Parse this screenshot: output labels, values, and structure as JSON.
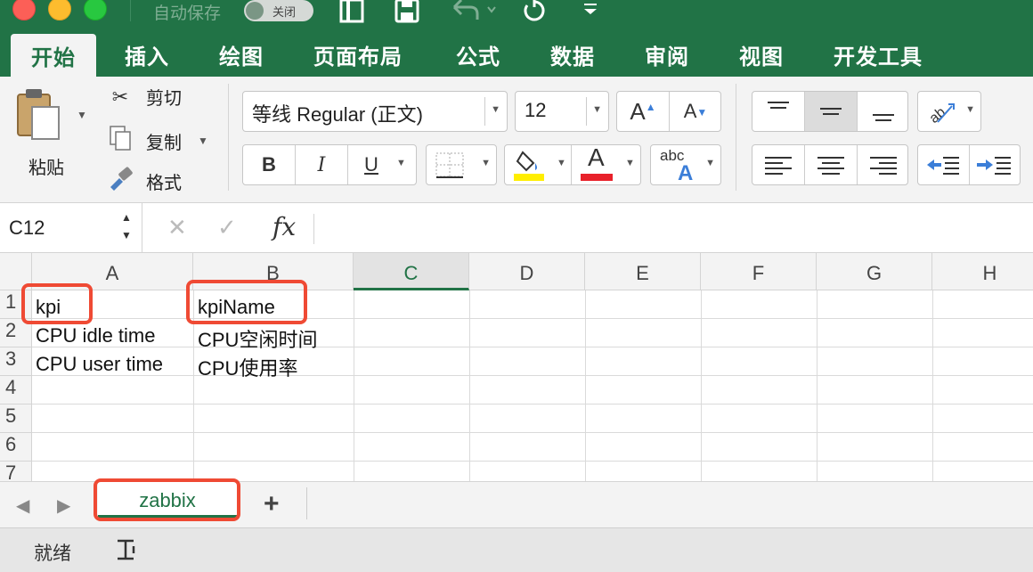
{
  "titlebar": {
    "autosave_label": "自动保存",
    "autosave_state": "关闭"
  },
  "tabs": [
    {
      "label": "开始",
      "active": true
    },
    {
      "label": "插入"
    },
    {
      "label": "绘图"
    },
    {
      "label": "页面布局"
    },
    {
      "label": "公式"
    },
    {
      "label": "数据"
    },
    {
      "label": "审阅"
    },
    {
      "label": "视图"
    },
    {
      "label": "开发工具"
    }
  ],
  "clipboard": {
    "paste": "粘贴",
    "cut": "剪切",
    "copy": "复制",
    "format": "格式"
  },
  "font": {
    "name": "等线 Regular (正文)",
    "size": "12",
    "bold": "B",
    "italic": "I",
    "underline": "U",
    "grow": "A",
    "shrink": "A",
    "color_letter": "A",
    "abc": "abc",
    "highlight_color": "#ffee00",
    "font_color": "#e8212a"
  },
  "formula_bar": {
    "name_box": "C12",
    "fx": "fx",
    "formula": ""
  },
  "sheet": {
    "columns": [
      "A",
      "B",
      "C",
      "D",
      "E",
      "F",
      "G",
      "H"
    ],
    "selected_column": "C",
    "rows": [
      "1",
      "2",
      "3",
      "4",
      "5",
      "6",
      "7"
    ],
    "cells": {
      "A1": "kpi",
      "B1": "kpiName",
      "A2": "CPU idle time",
      "B2": "CPU空闲时间",
      "A3": "CPU user time",
      "B3": "CPU使用率"
    }
  },
  "sheet_tabs": {
    "active": "zabbix",
    "add": "+"
  },
  "status": {
    "text": "就绪"
  },
  "colors": {
    "accent": "#217346",
    "highlight_box": "#ef4a34"
  }
}
